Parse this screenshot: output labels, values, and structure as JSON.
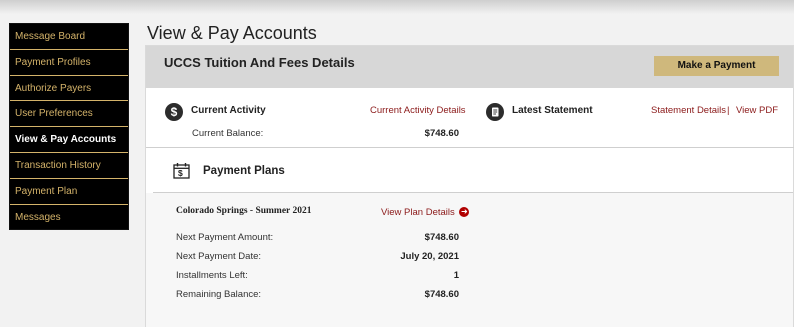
{
  "sidebar": {
    "items": [
      {
        "label": "Message Board"
      },
      {
        "label": "Payment Profiles"
      },
      {
        "label": "Authorize Payers"
      },
      {
        "label": "User Preferences"
      },
      {
        "label": "View & Pay Accounts",
        "active": true
      },
      {
        "label": "Transaction History"
      },
      {
        "label": "Payment Plan"
      },
      {
        "label": "Messages"
      }
    ]
  },
  "page": {
    "title": "View & Pay Accounts"
  },
  "account": {
    "title": "UCCS Tuition And Fees Details",
    "pay_button": "Make a Payment",
    "current_activity": {
      "icon_glyph": "$",
      "label": "Current Activity",
      "link": "Current Activity Details",
      "balance_label": "Current Balance:",
      "balance_value": "$748.60"
    },
    "latest_statement": {
      "label": "Latest Statement",
      "details_link": "Statement Details",
      "separator": "|",
      "pdf_link": "View PDF"
    }
  },
  "payment_plans": {
    "title": "Payment Plans",
    "icon_glyph": "$",
    "plan": {
      "name": "Colorado Springs - Summer 2021",
      "details_link": "View Plan Details",
      "rows": [
        {
          "label": "Next Payment Amount:",
          "value": "$748.60"
        },
        {
          "label": "Next Payment Date:",
          "value": "July 20, 2021"
        },
        {
          "label": "Installments Left:",
          "value": "1"
        },
        {
          "label": "Remaining Balance:",
          "value": "$748.60"
        }
      ]
    }
  },
  "colors": {
    "accent_gold": "#cfb87c",
    "link_red": "#8b1a1a",
    "sidebar_bg": "#000000"
  }
}
